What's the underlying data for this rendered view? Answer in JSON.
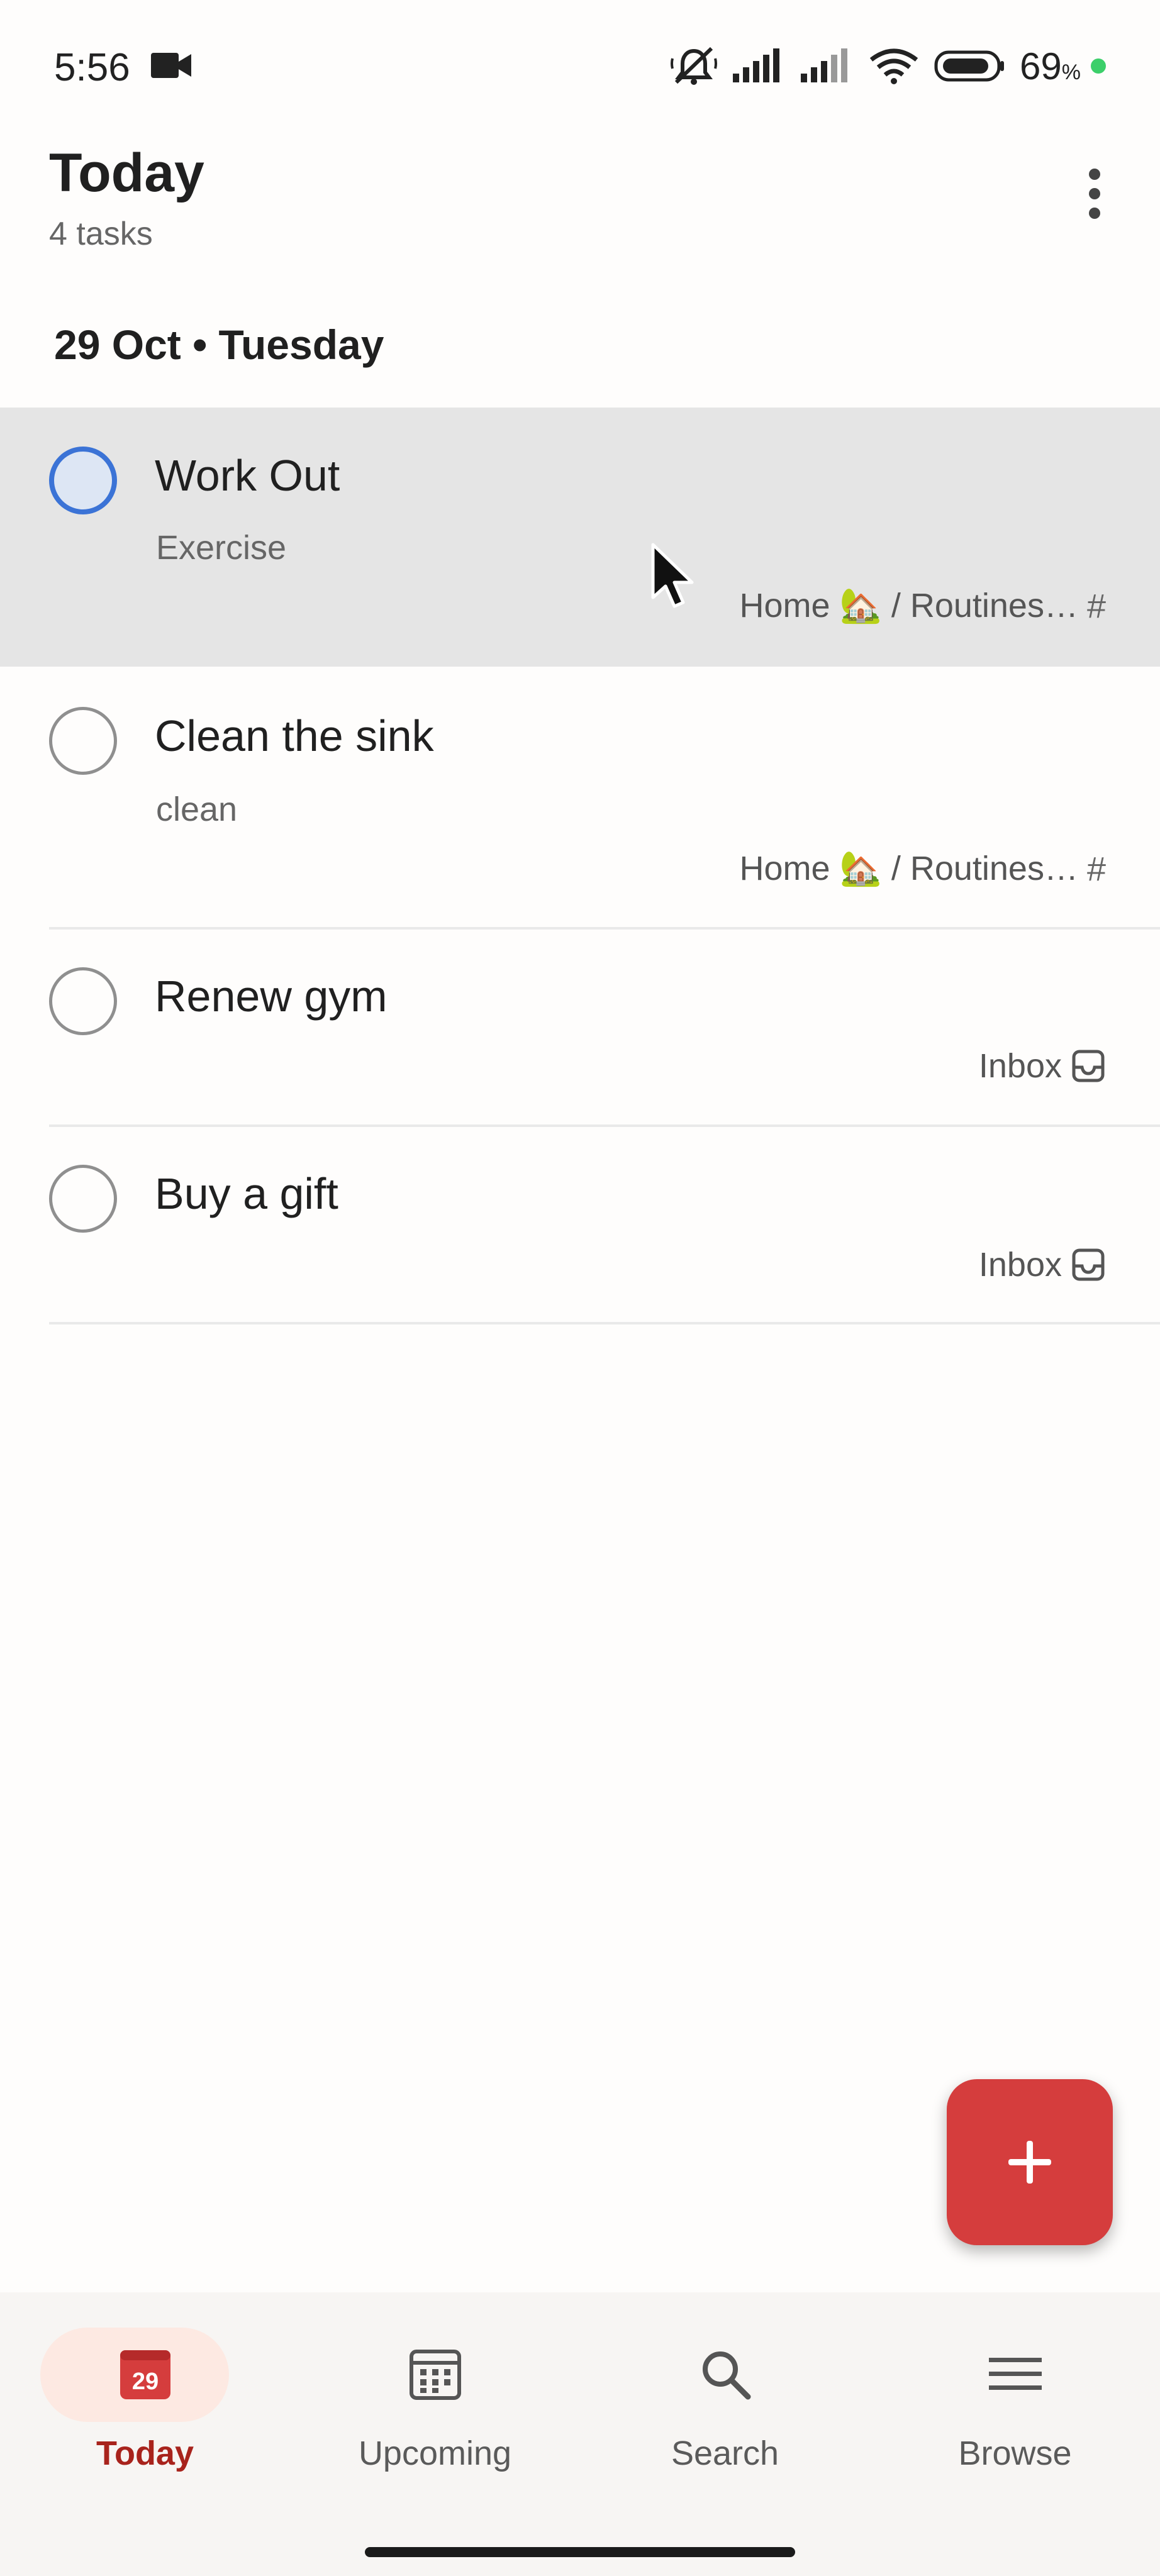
{
  "status_bar": {
    "time": "5:56",
    "battery_percent": "69",
    "battery_unit": "%",
    "icons": [
      "video-camera-icon",
      "mute-icon",
      "signal-icon",
      "signal-icon",
      "wifi-icon",
      "battery-icon"
    ]
  },
  "header": {
    "title": "Today",
    "subtitle": "4 tasks",
    "more_icon": "more-vertical-icon"
  },
  "date_heading": "29 Oct • Tuesday",
  "tasks": [
    {
      "name": "Work Out",
      "description": "Exercise",
      "project": "Home 🏡 / Routines…",
      "project_icon": "hash-icon",
      "hovered": true
    },
    {
      "name": "Clean the sink",
      "description": "clean",
      "project": "Home 🏡 / Routines…",
      "project_icon": "hash-icon",
      "hovered": false
    },
    {
      "name": "Renew gym",
      "description": "",
      "project": "Inbox",
      "project_icon": "inbox-icon",
      "hovered": false
    },
    {
      "name": "Buy a gift",
      "description": "",
      "project": "Inbox",
      "project_icon": "inbox-icon",
      "hovered": false
    }
  ],
  "fab": {
    "icon": "plus-icon",
    "color": "#d53d3d"
  },
  "bottom_nav": {
    "items": [
      {
        "label": "Today",
        "icon": "calendar-today-icon",
        "icon_number": "29",
        "active": true
      },
      {
        "label": "Upcoming",
        "icon": "calendar-grid-icon",
        "active": false
      },
      {
        "label": "Search",
        "icon": "search-icon",
        "active": false
      },
      {
        "label": "Browse",
        "icon": "menu-icon",
        "active": false
      }
    ]
  },
  "colors": {
    "accent": "#d53d3d",
    "active_nav": "#a8231c",
    "checkbox_active": "#3b73d6",
    "highlight_row": "#e5e5e5"
  }
}
